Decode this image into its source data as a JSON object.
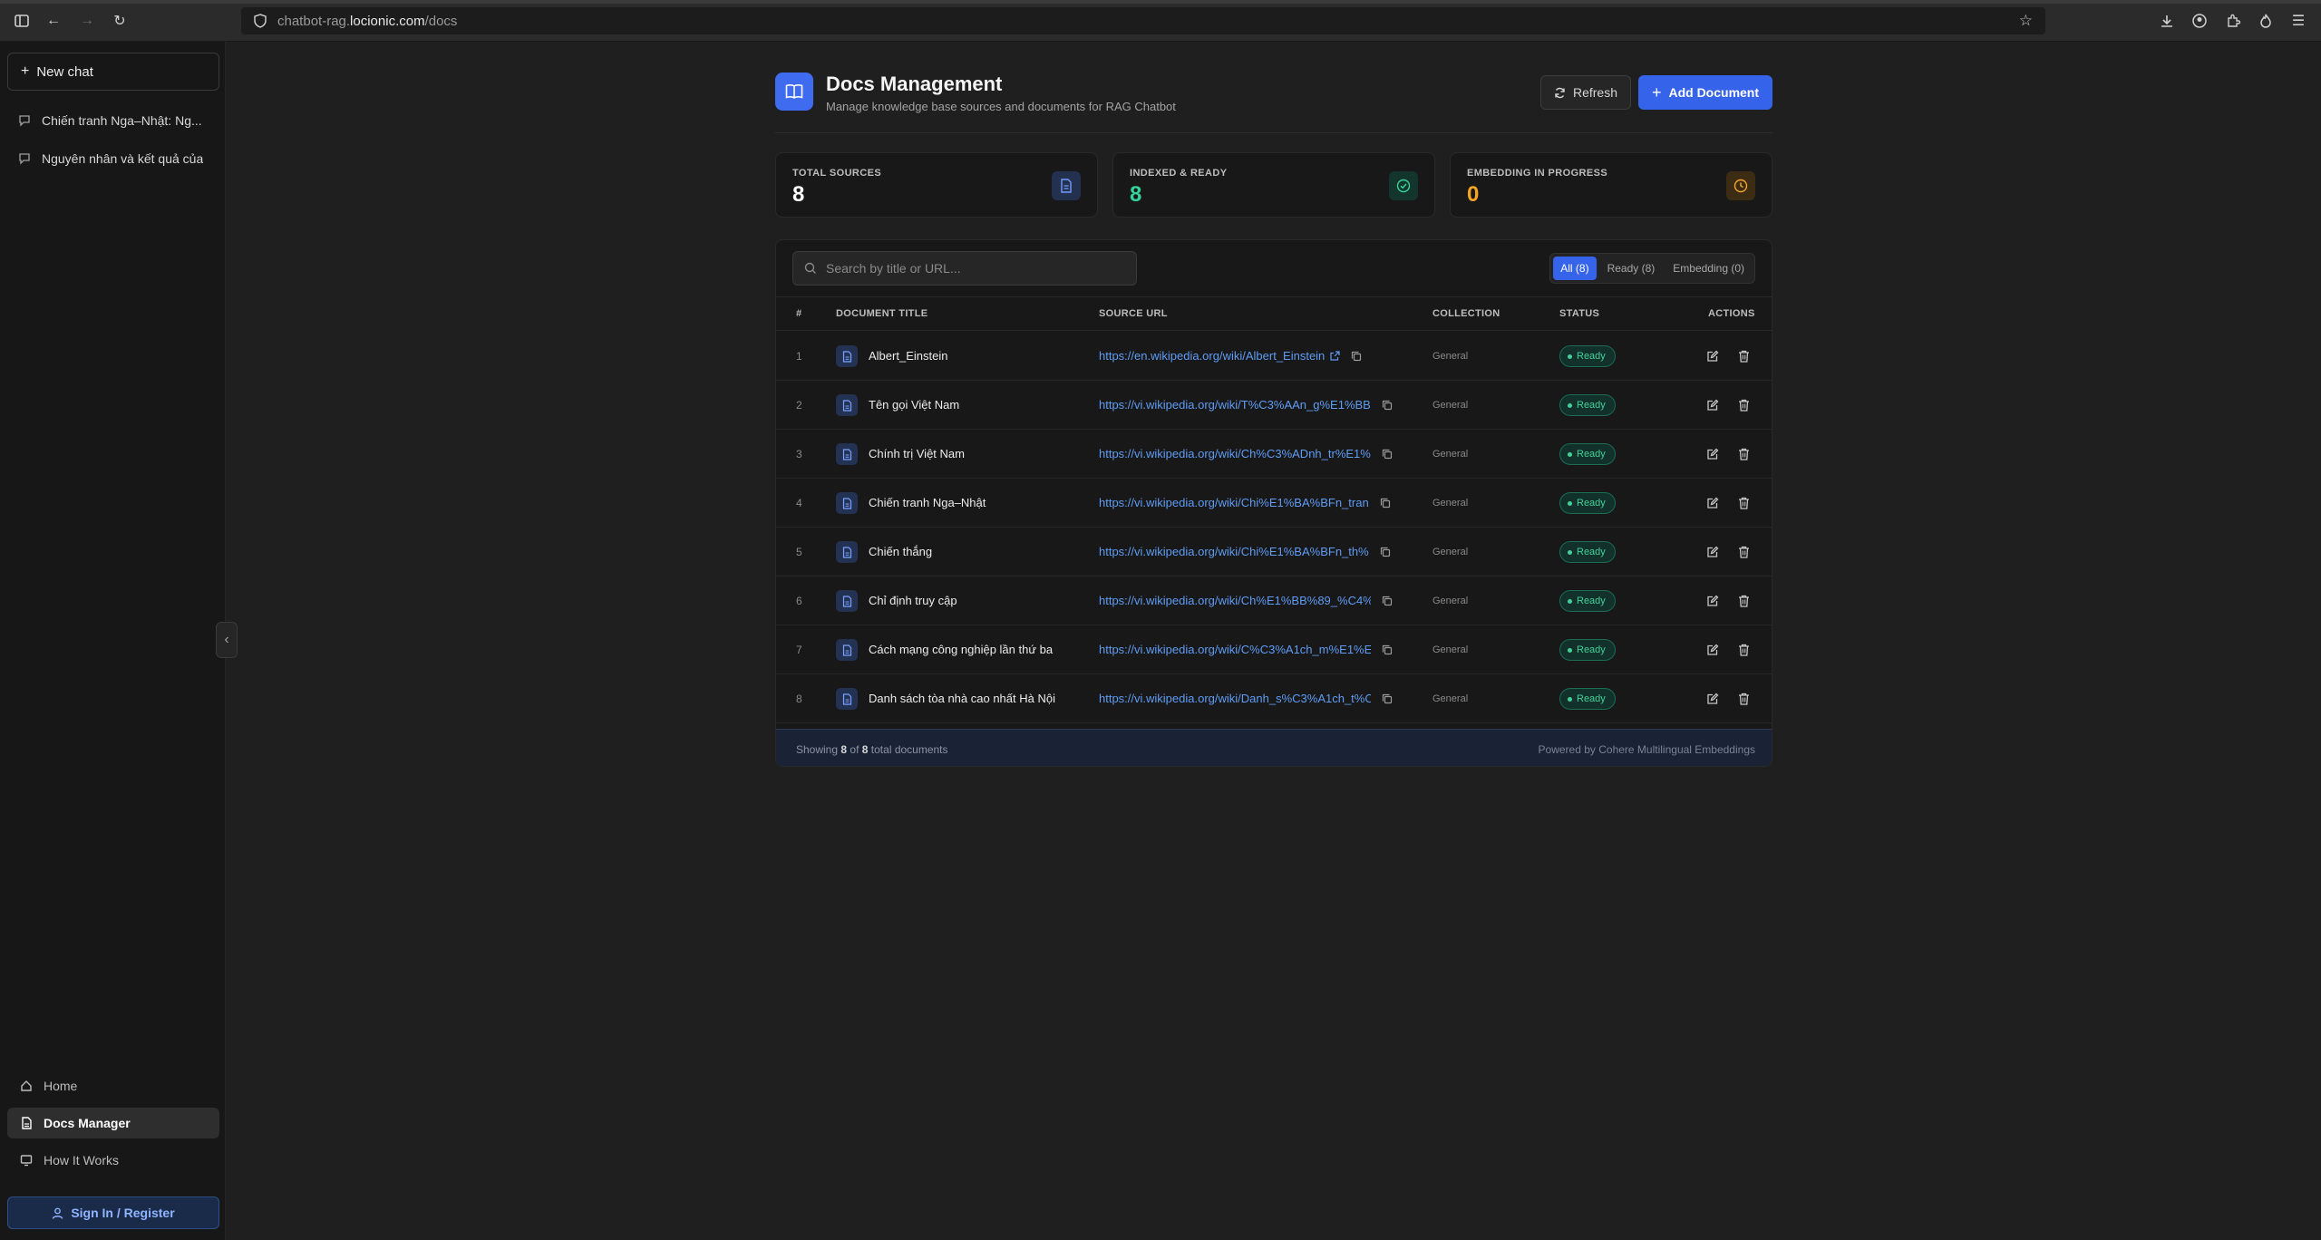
{
  "browser": {
    "url_prefix": "chatbot-rag.",
    "url_domain": "locionic.com",
    "url_path": "/docs"
  },
  "sidebar": {
    "new_chat": "New chat",
    "chats": [
      {
        "label": "Chiến tranh Nga–Nhật: Ng..."
      },
      {
        "label": "Nguyên nhân và kết quả của"
      }
    ],
    "nav": [
      {
        "label": "Home"
      },
      {
        "label": "Docs Manager"
      },
      {
        "label": "How It Works"
      }
    ],
    "sign_in": "Sign In / Register"
  },
  "header": {
    "title": "Docs Management",
    "subtitle": "Manage knowledge base sources and documents for RAG Chatbot",
    "refresh": "Refresh",
    "add": "Add Document"
  },
  "stats": [
    {
      "label": "TOTAL SOURCES",
      "value": "8",
      "color": "#ffffff"
    },
    {
      "label": "INDEXED & READY",
      "value": "8",
      "color": "#34d399"
    },
    {
      "label": "EMBEDDING IN PROGRESS",
      "value": "0",
      "color": "#f5a524"
    }
  ],
  "search": {
    "placeholder": "Search by title or URL..."
  },
  "filters": [
    {
      "label": "All (8)",
      "active": true
    },
    {
      "label": "Ready (8)",
      "active": false
    },
    {
      "label": "Embedding (0)",
      "active": false
    }
  ],
  "table": {
    "columns": [
      "#",
      "DOCUMENT TITLE",
      "SOURCE URL",
      "COLLECTION",
      "STATUS",
      "ACTIONS"
    ],
    "rows": [
      {
        "n": "1",
        "title": "Albert_Einstein",
        "url": "https://en.wikipedia.org/wiki/Albert_Einstein",
        "collection": "General",
        "status": "Ready"
      },
      {
        "n": "2",
        "title": "Tên gọi Việt Nam",
        "url": "https://vi.wikipedia.org/wiki/T%C3%AAn_g%E1%BB",
        "collection": "General",
        "status": "Ready"
      },
      {
        "n": "3",
        "title": "Chính trị Việt Nam",
        "url": "https://vi.wikipedia.org/wiki/Ch%C3%ADnh_tr%E1%",
        "collection": "General",
        "status": "Ready"
      },
      {
        "n": "4",
        "title": "Chiến tranh Nga–Nhật",
        "url": "https://vi.wikipedia.org/wiki/Chi%E1%BA%BFn_tran",
        "collection": "General",
        "status": "Ready"
      },
      {
        "n": "5",
        "title": "Chiến thắng",
        "url": "https://vi.wikipedia.org/wiki/Chi%E1%BA%BFn_th%",
        "collection": "General",
        "status": "Ready"
      },
      {
        "n": "6",
        "title": "Chỉ định truy cập",
        "url": "https://vi.wikipedia.org/wiki/Ch%E1%BB%89_%C4%",
        "collection": "General",
        "status": "Ready"
      },
      {
        "n": "7",
        "title": "Cách mạng công nghiệp lần thứ ba",
        "url": "https://vi.wikipedia.org/wiki/C%C3%A1ch_m%E1%E",
        "collection": "General",
        "status": "Ready"
      },
      {
        "n": "8",
        "title": "Danh sách tòa nhà cao nhất Hà Nội",
        "url": "https://vi.wikipedia.org/wiki/Danh_s%C3%A1ch_t%C",
        "collection": "General",
        "status": "Ready"
      }
    ]
  },
  "footer": {
    "showing_prefix": "Showing",
    "shown": "8",
    "of": "of",
    "total": "8",
    "suffix": "total documents",
    "powered": "Powered by Cohere Multilingual Embeddings"
  }
}
